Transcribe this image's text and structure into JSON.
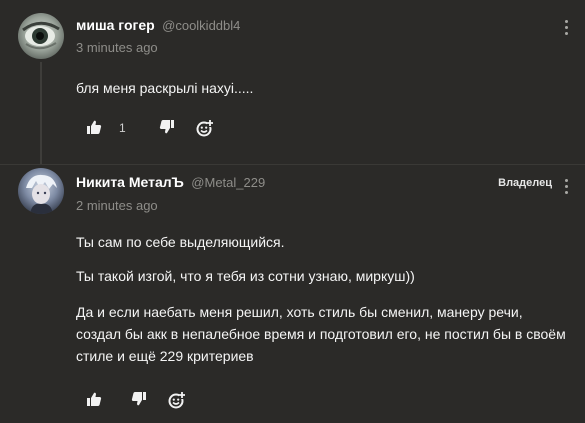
{
  "comments": [
    {
      "username": "миша гогер",
      "handle": "@coolkiddbl4",
      "time": "3 minutes ago",
      "paragraphs": [
        "бля меня раскрылі нахуі....."
      ],
      "likes": "1",
      "icons": {
        "like": "thumbs-up-icon",
        "dislike": "thumbs-down-icon",
        "react": "add-reaction-icon",
        "menu": "kebab-menu-icon"
      }
    },
    {
      "username": "Никита МеталЪ",
      "handle": "@Metal_229",
      "time": "2 minutes ago",
      "badge": "Владелец",
      "paragraphs": [
        "Ты сам по себе выделяющийся.",
        "Ты такой изгой, что я тебя из сотни узнаю, миркуш))",
        "Да и если наебать меня решил, хоть стиль бы сменил, манеру речи, создал бы акк в непалебное время и подготовил его, не постил бы в своём стиле и ещё 229 критериев"
      ],
      "icons": {
        "like": "thumbs-up-icon",
        "dislike": "thumbs-down-icon",
        "react": "add-reaction-icon",
        "menu": "kebab-menu-icon"
      }
    }
  ],
  "colors": {
    "background": "#2b2a28",
    "text": "#f5f5f5",
    "muted": "#8e8d89"
  }
}
